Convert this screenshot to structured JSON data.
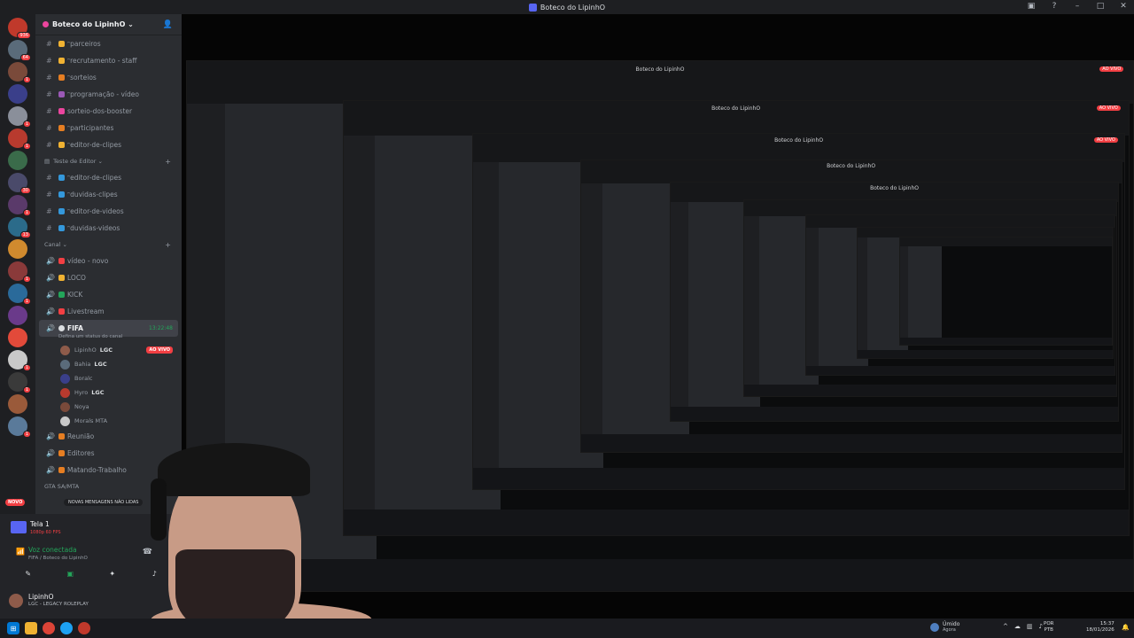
{
  "window": {
    "title": "Boteco do LipinhO"
  },
  "servers": {
    "items": [
      {
        "color": "#c0392b",
        "badge": "936"
      },
      {
        "color": "#5a6b7a",
        "badge": "64"
      },
      {
        "color": "#7a4a3a",
        "badge": "1"
      },
      {
        "color": "#3a3f8a",
        "badge": ""
      },
      {
        "color": "#8a8f9a",
        "badge": "1"
      },
      {
        "color": "#b83a2e",
        "badge": "1"
      },
      {
        "color": "#3a6b4a",
        "badge": ""
      },
      {
        "color": "#4a4a6a",
        "badge": "30"
      },
      {
        "color": "#5a3a6a",
        "badge": "1"
      },
      {
        "color": "#2b6b8a",
        "badge": "13"
      },
      {
        "color": "#d08a2e",
        "badge": ""
      },
      {
        "color": "#8a3a3a",
        "badge": "1"
      },
      {
        "color": "#2a6a9a",
        "badge": "1"
      },
      {
        "color": "#6a3a8a",
        "badge": ""
      },
      {
        "color": "#e24a3a",
        "badge": ""
      },
      {
        "color": "#c9c9c9",
        "badge": "1"
      },
      {
        "color": "#3a3a3a",
        "badge": "1"
      },
      {
        "color": "#9a5a3a",
        "badge": ""
      },
      {
        "color": "#5a7a9a",
        "badge": "1"
      }
    ]
  },
  "guild": {
    "name": "Boteco do LipinhO"
  },
  "channels": {
    "top": [
      {
        "name": "ᵔparceiros",
        "color": "#f0b232"
      },
      {
        "name": "ᵔrecrutamento - staff",
        "color": "#f0b232"
      },
      {
        "name": "ᵔsorteios",
        "color": "#e67e22"
      },
      {
        "name": "ᵔprogramação - vídeo",
        "color": "#9b59b6"
      },
      {
        "name": "sorteio-dos-booster",
        "color": "#eb459e"
      },
      {
        "name": "ᵔparticipantes",
        "color": "#e67e22"
      },
      {
        "name": "ᵔeditor-de-clipes",
        "color": "#f0b232"
      }
    ],
    "cat_editor": "Teste de Editor",
    "editor": [
      {
        "name": "ᵔeditor-de-clipes",
        "color": "#3498db"
      },
      {
        "name": "ᵔduvidas-clipes",
        "color": "#3498db"
      },
      {
        "name": "ᵔeditor-de-videos",
        "color": "#3498db"
      },
      {
        "name": "ᵔduvidas-videos",
        "color": "#3498db"
      }
    ],
    "cat_canal": "Canal",
    "voice": [
      {
        "name": "vídeo - novo",
        "color": "#f23f43"
      },
      {
        "name": "LOCO",
        "color": "#f0b232"
      },
      {
        "name": "KICK",
        "color": "#23a55a"
      },
      {
        "name": "Livestream",
        "color": "#f23f43"
      }
    ],
    "active": {
      "name": "FIFA",
      "time": "13:22:48",
      "status": "Defina um status do canal"
    },
    "voice_users": [
      {
        "name": "LipinhO",
        "tag": "LGC",
        "live": "AO VIVO",
        "color": "#8e5b4a"
      },
      {
        "name": "Bahia",
        "tag": "LGC",
        "live": "",
        "color": "#5a6b7a"
      },
      {
        "name": "Boralc",
        "tag": "",
        "live": "",
        "color": "#3a3f8a"
      },
      {
        "name": "Hyro",
        "tag": "LGC",
        "live": "",
        "color": "#b83a2e"
      },
      {
        "name": "Noya",
        "tag": "",
        "live": "",
        "color": "#7a4a3a"
      },
      {
        "name": "Morals MTA",
        "tag": "",
        "live": "",
        "color": "#c9c9c9"
      }
    ],
    "after": [
      {
        "name": "Reunião",
        "color": "#e67e22"
      },
      {
        "name": "Editores",
        "color": "#e67e22"
      },
      {
        "name": "Matando-Trabalho",
        "color": "#e67e22"
      }
    ],
    "cat_gta": "GTA SA/MTA"
  },
  "unread_pill": "NOVAS MENSAGENS NÃO LIDAS",
  "novo_badge": "NOVO",
  "panel": {
    "screen_title": "Tela 1",
    "screen_sub": "1080p 60 FPS",
    "voice_status": "Voz conectada",
    "voice_channel": "FIFA / Boteco do LipinhO",
    "user_name": "LipinhO",
    "user_status": "LGC - LEGACY ROLEPLAY"
  },
  "stream": {
    "live_label": "AO VIVO",
    "title": "Boteco do LipinhO"
  },
  "taskbar": {
    "weather_label": "Úmido",
    "weather_sub": "Agora",
    "lang1": "POR",
    "lang2": "PTB",
    "time": "15:37",
    "date": "18/01/2026"
  }
}
